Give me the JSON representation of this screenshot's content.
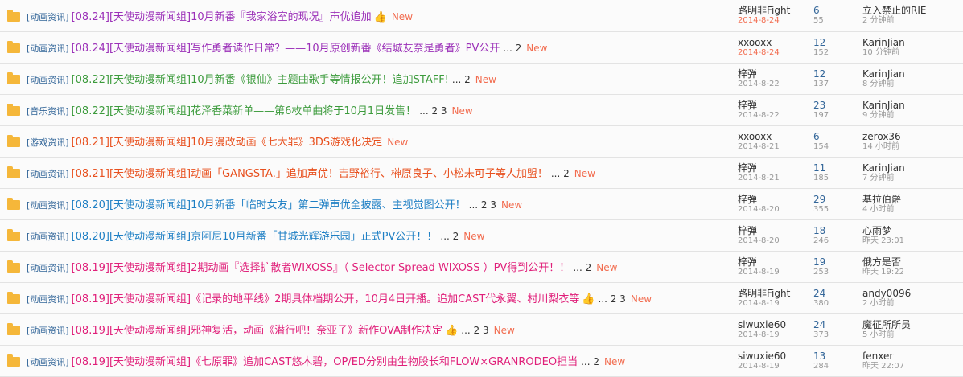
{
  "threads": [
    {
      "category": "[动画资讯]",
      "title": "[08.24][天使动漫新闻组]10月新番『我家浴室的现况』声优追加",
      "color": "#9b30b8",
      "thumb": true,
      "pages": "",
      "new_label": "New",
      "author": "路明非Fight",
      "date": "2014-8-24",
      "date_hot": true,
      "replies": "6",
      "views": "55",
      "last_author": "立入禁止的RIE",
      "last_time": "2 分钟前"
    },
    {
      "category": "[动画资讯]",
      "title": "[08.24][天使动漫新闻组]写作勇者读作日常？——10月原创新番《结城友奈是勇者》PV公开",
      "color": "#9b30b8",
      "thumb": false,
      "pages": "... 2",
      "new_label": "New",
      "author": "xxooxx",
      "date": "2014-8-24",
      "date_hot": true,
      "replies": "12",
      "views": "152",
      "last_author": "KarinJian",
      "last_time": "10 分钟前"
    },
    {
      "category": "[动画资讯]",
      "title": "[08.22][天使动漫新闻组]10月新番《银仙》主题曲歌手等情报公开！追加STAFF!",
      "color": "#3c9b3c",
      "thumb": false,
      "pages": "... 2",
      "new_label": "New",
      "author": "梓弹",
      "date": "2014-8-22",
      "date_hot": false,
      "replies": "12",
      "views": "137",
      "last_author": "KarinJian",
      "last_time": "8 分钟前"
    },
    {
      "category": "[音乐资讯]",
      "title": "[08.22][天使动漫新闻组]花泽香菜新单——第6枚单曲将于10月1日发售！",
      "color": "#3c9b3c",
      "thumb": false,
      "pages": "... 2 3",
      "new_label": "New",
      "author": "梓弹",
      "date": "2014-8-22",
      "date_hot": false,
      "replies": "23",
      "views": "197",
      "last_author": "KarinJian",
      "last_time": "9 分钟前"
    },
    {
      "category": "[游戏资讯]",
      "title": "[08.21][天使动漫新闻组]10月漫改动画《七大罪》3DS游戏化决定",
      "color": "#e8501e",
      "thumb": false,
      "pages": "",
      "new_label": "New",
      "author": "xxooxx",
      "date": "2014-8-21",
      "date_hot": false,
      "replies": "6",
      "views": "154",
      "last_author": "zerox36",
      "last_time": "14 小时前"
    },
    {
      "category": "[动画资讯]",
      "title": "[08.21][天使动漫新闻组]动画「GANGSTA.」追加声优！吉野裕行、榊原良子、小松未可子等人加盟！",
      "color": "#e8501e",
      "thumb": false,
      "pages": "... 2",
      "new_label": "New",
      "author": "梓弹",
      "date": "2014-8-21",
      "date_hot": false,
      "replies": "11",
      "views": "185",
      "last_author": "KarinJian",
      "last_time": "7 分钟前"
    },
    {
      "category": "[动画资讯]",
      "title": "[08.20][天使动漫新闻组]10月新番「临时女友」第二弹声优全披露、主视觉图公开！",
      "color": "#1e7fc4",
      "thumb": false,
      "pages": "... 2 3",
      "new_label": "New",
      "author": "梓弹",
      "date": "2014-8-20",
      "date_hot": false,
      "replies": "29",
      "views": "355",
      "last_author": "基拉伯爵",
      "last_time": "4 小时前"
    },
    {
      "category": "[动画资讯]",
      "title": "[08.20][天使动漫新闻组]京阿尼10月新番「甘城光辉游乐园」正式PV公开！！",
      "color": "#1e7fc4",
      "thumb": false,
      "pages": "... 2",
      "new_label": "New",
      "author": "梓弹",
      "date": "2014-8-20",
      "date_hot": false,
      "replies": "18",
      "views": "246",
      "last_author": "心雨梦",
      "last_time": "昨天 23:01"
    },
    {
      "category": "[动画资讯]",
      "title": "[08.19][天使动漫新闻组]2期动画『选择扩散者WIXOSS』（ Selector Spread WIXOSS ）PV得到公开！！",
      "color": "#e0207a",
      "thumb": false,
      "pages": "... 2",
      "new_label": "New",
      "author": "梓弹",
      "date": "2014-8-19",
      "date_hot": false,
      "replies": "19",
      "views": "253",
      "last_author": "俄方是否",
      "last_time": "昨天 19:22"
    },
    {
      "category": "[动画资讯]",
      "title": "[08.19][天使动漫新闻组]《记录的地平线》2期具体档期公开，10月4日开播。追加CAST代永翼、村川梨衣等",
      "color": "#e0207a",
      "thumb": true,
      "pages": "... 2 3",
      "new_label": "New",
      "author": "路明非Fight",
      "date": "2014-8-19",
      "date_hot": false,
      "replies": "24",
      "views": "380",
      "last_author": "andy0096",
      "last_time": "2 小时前"
    },
    {
      "category": "[动画资讯]",
      "title": "[08.19][天使动漫新闻组]邪神复活，动画《潜行吧！奈亚子》新作OVA制作决定",
      "color": "#e0207a",
      "thumb": true,
      "pages": "... 2 3",
      "new_label": "New",
      "author": "siwuxie60",
      "date": "2014-8-19",
      "date_hot": false,
      "replies": "24",
      "views": "373",
      "last_author": "魔征所所员",
      "last_time": "5 小时前"
    },
    {
      "category": "[动画资讯]",
      "title": "[08.19][天使动漫新闻组]《七原罪》追加CAST悠木碧，OP/ED分别由生物股长和FLOW×GRANRODEO担当",
      "color": "#e0207a",
      "thumb": false,
      "pages": "... 2",
      "new_label": "New",
      "author": "siwuxie60",
      "date": "2014-8-19",
      "date_hot": false,
      "replies": "13",
      "views": "284",
      "last_author": "fenxer",
      "last_time": "昨天 22:07"
    }
  ]
}
